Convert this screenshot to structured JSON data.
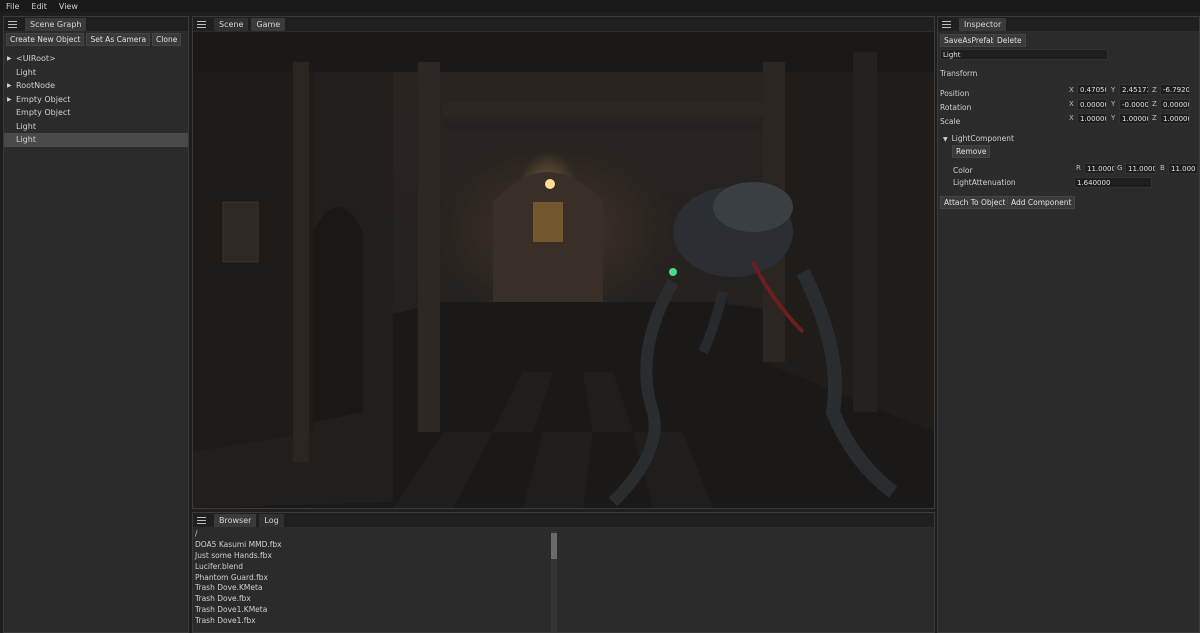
{
  "menu": {
    "file": "File",
    "edit": "Edit",
    "view": "View"
  },
  "scene_graph": {
    "tab": "Scene Graph",
    "buttons": {
      "create": "Create New Object",
      "set_camera": "Set As Camera",
      "clone": "Clone"
    },
    "items": [
      {
        "label": "<UIRoot>",
        "expandable": true
      },
      {
        "label": "Light",
        "expandable": false
      },
      {
        "label": "RootNode",
        "expandable": true
      },
      {
        "label": "Empty Object",
        "expandable": true
      },
      {
        "label": "Empty Object",
        "expandable": false
      },
      {
        "label": "Light",
        "expandable": false
      },
      {
        "label": "Light",
        "expandable": false,
        "selected": true
      }
    ]
  },
  "viewport": {
    "tabs": [
      "Scene",
      "Game"
    ]
  },
  "browser": {
    "tabs": [
      "Browser",
      "Log"
    ],
    "path": "/",
    "files": [
      "DOA5 Kasumi MMD.fbx",
      "Just some Hands.fbx",
      "Lucifer.blend",
      "Phantom Guard.fbx",
      "Trash Dove.KMeta",
      "Trash Dove.fbx",
      "Trash Dove1.KMeta",
      "Trash Dove1.fbx"
    ]
  },
  "inspector": {
    "tab": "Inspector",
    "buttons": {
      "save_prefab": "SaveAsPrefab",
      "delete": "Delete"
    },
    "object_name": "Light",
    "transform_label": "Transform",
    "position": {
      "label": "Position",
      "x": "0.47050",
      "y": "2.45173",
      "z": "-6.7920"
    },
    "rotation": {
      "label": "Rotation",
      "x": "0.00000",
      "y": "-0.0000",
      "z": "0.00000"
    },
    "scale": {
      "label": "Scale",
      "x": "1.00000",
      "y": "1.00000",
      "z": "1.00000"
    },
    "axis": {
      "x": "X",
      "y": "Y",
      "z": "Z",
      "r": "R",
      "g": "G",
      "b": "B"
    },
    "component": {
      "name": "LightComponent",
      "remove": "Remove",
      "color_label": "Color",
      "r": "11.0000",
      "g": "11.0000",
      "b": "11.000",
      "attenuation_label": "LightAttenuation",
      "attenuation": "1.640000"
    },
    "attach": "Attach To Object",
    "add_component": "Add Component"
  }
}
